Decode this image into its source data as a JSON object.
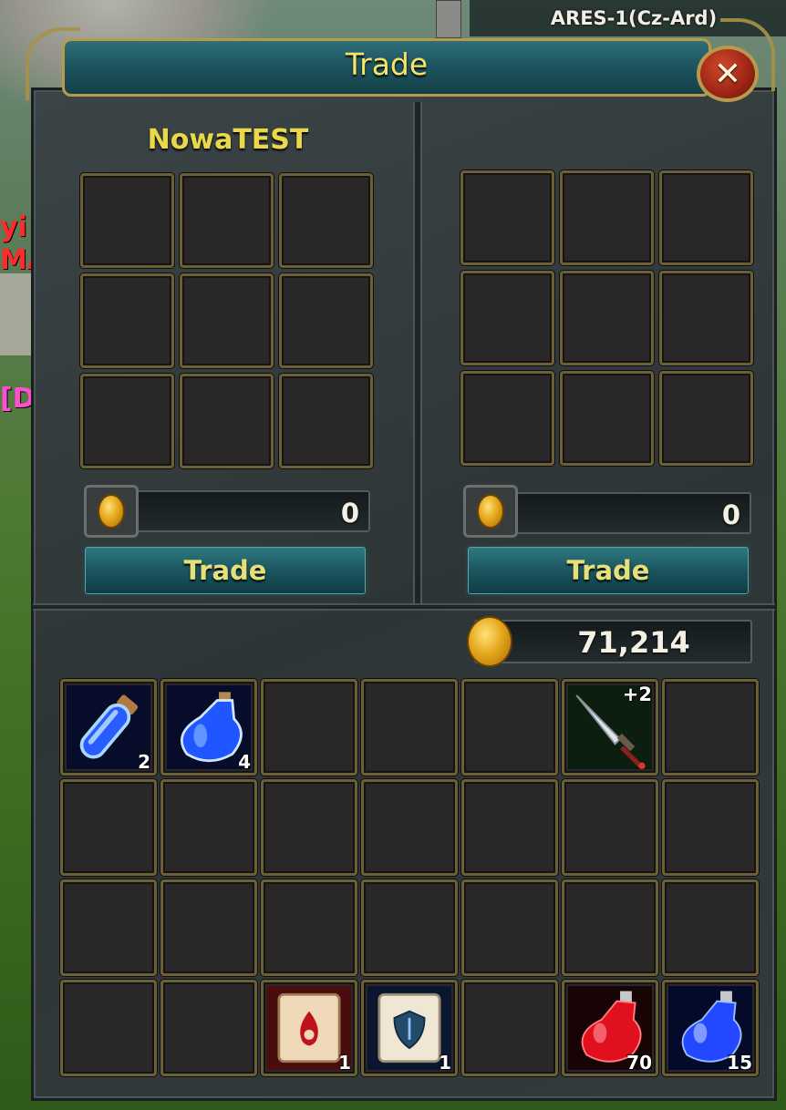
{
  "server": {
    "name": "ARES-1(Cz-Ard)"
  },
  "background": {
    "red_text": "yi\nMA",
    "pink_text": "[D"
  },
  "window": {
    "title": "Trade",
    "close_label": "✕"
  },
  "left_panel": {
    "player_name": "NowaTEST",
    "slots": [
      "",
      "",
      "",
      "",
      "",
      "",
      "",
      "",
      ""
    ],
    "gold": "0",
    "trade_button": "Trade"
  },
  "right_panel": {
    "player_name": "",
    "slots": [
      "",
      "",
      "",
      "",
      "",
      "",
      "",
      "",
      ""
    ],
    "gold": "0",
    "trade_button": "Trade"
  },
  "inventory": {
    "gold": "71,214",
    "items": [
      {
        "slot": 0,
        "icon": "blue-vial-icon",
        "qty": "2"
      },
      {
        "slot": 1,
        "icon": "blue-flask-icon",
        "qty": "4"
      },
      {
        "slot": 5,
        "icon": "dagger-icon",
        "enhance": "+2"
      },
      {
        "slot": 23,
        "icon": "red-scroll-icon",
        "qty": "1"
      },
      {
        "slot": 24,
        "icon": "shield-scroll-icon",
        "qty": "1"
      },
      {
        "slot": 26,
        "icon": "red-potion-icon",
        "qty": "70"
      },
      {
        "slot": 27,
        "icon": "blue-potion-icon",
        "qty": "15"
      }
    ]
  },
  "colors": {
    "title": "#f3e46a",
    "name": "#e9d84a",
    "slot_border": "#6c5f35",
    "button": "#1b5560"
  }
}
